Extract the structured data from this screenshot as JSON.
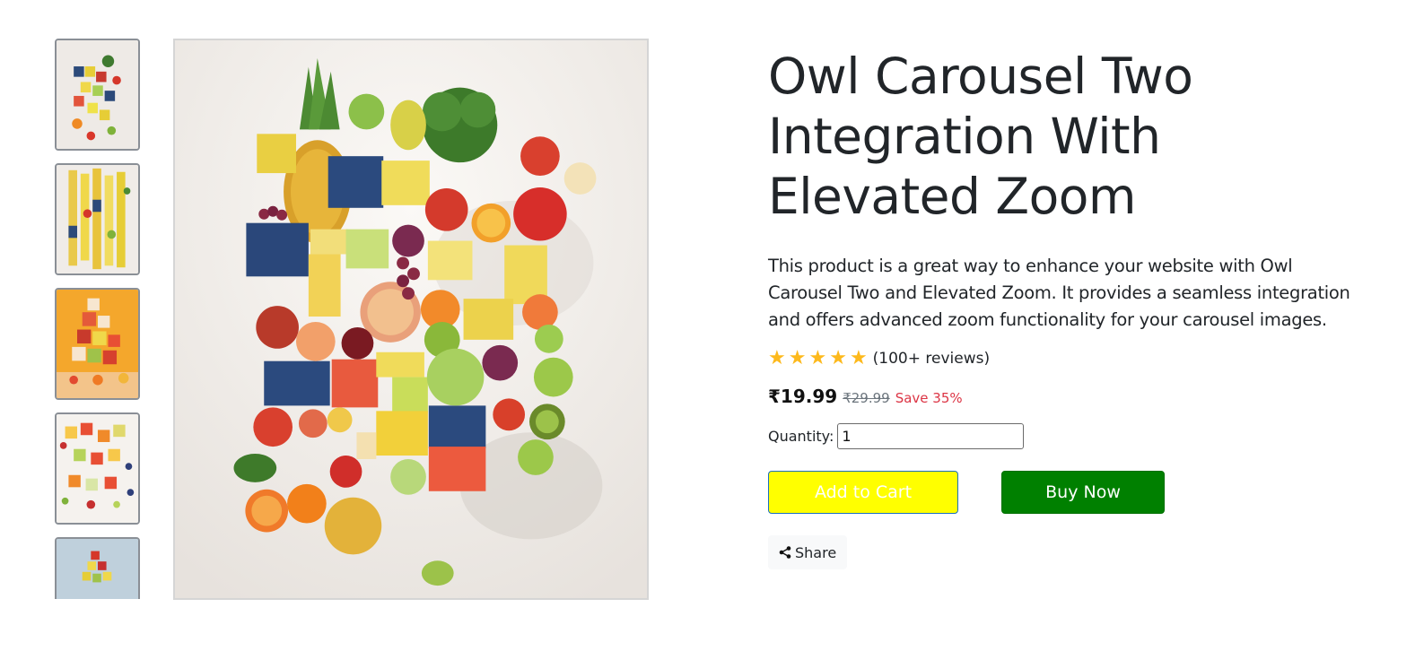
{
  "product": {
    "title": "Owl Carousel Two Integration With Elevated Zoom",
    "description": "This product is a great way to enhance your website with Owl Carousel Two and Elevated Zoom. It provides a seamless integration and offers advanced zoom functionality for your carousel images.",
    "rating": {
      "stars": 5,
      "reviews_text": "(100+ reviews)",
      "star_color": "#fdb91c"
    },
    "price": {
      "current": "₹19.99",
      "original": "₹29.99",
      "save_text": "Save 35%"
    },
    "quantity": {
      "label": "Quantity:",
      "value": "1"
    },
    "buttons": {
      "add_to_cart": "Add to Cart",
      "buy_now": "Buy Now",
      "share": "Share"
    }
  },
  "gallery": {
    "thumbnail_count": 5,
    "selected_index": 0
  },
  "colors": {
    "add_to_cart_bg": "#ffff00",
    "buy_now_bg": "#008000",
    "save_text": "#dc3545"
  }
}
